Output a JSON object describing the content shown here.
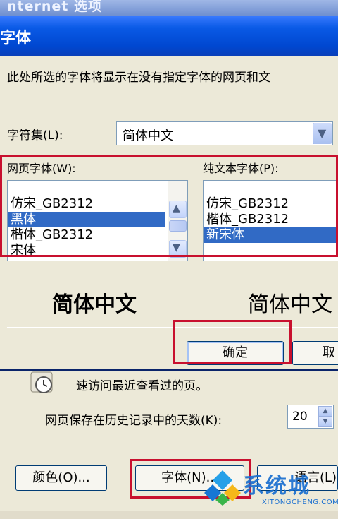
{
  "background_window": {
    "title": "nternet 选项"
  },
  "font_dialog": {
    "title": "字体",
    "description": "此处所选的字体将显示在没有指定字体的网页和文",
    "charset_label": "字符集(L):",
    "charset_value": "简体中文",
    "webpage_font_label": "网页字体(W):",
    "plain_text_font_label": "纯文本字体(P):",
    "webpage_fonts": [
      {
        "name": "仿宋_GB2312",
        "selected": false
      },
      {
        "name": "黑体",
        "selected": true
      },
      {
        "name": "楷体_GB2312",
        "selected": false
      },
      {
        "name": "宋体",
        "selected": false
      }
    ],
    "plain_text_fonts": [
      {
        "name": "仿宋_GB2312",
        "selected": false
      },
      {
        "name": "楷体_GB2312",
        "selected": false
      },
      {
        "name": "新宋体",
        "selected": true
      }
    ],
    "preview_webpage": "简体中文",
    "preview_plain": "简体中文",
    "ok_label": "确定",
    "cancel_label": "取"
  },
  "internet_options": {
    "history_text": "速访问最近查看过的页。",
    "days_label": "网页保存在历史记录中的天数(K):",
    "days_value": "20",
    "colors_button": "颜色(O)...",
    "font_button": "字体(N)...",
    "languages_button": "语言(L)"
  },
  "watermark": {
    "text": "系统城",
    "url": "XITONGCHENG.COM"
  },
  "colors": {
    "titlebar": "#0047d0",
    "selection": "#316ac5",
    "highlight_box": "#c8102e"
  },
  "icons": [
    "history-clock-icon",
    "dropdown-arrow-icon",
    "scroll-up-icon",
    "scroll-down-icon",
    "spin-up-icon",
    "spin-down-icon",
    "watermark-logo-icon"
  ]
}
